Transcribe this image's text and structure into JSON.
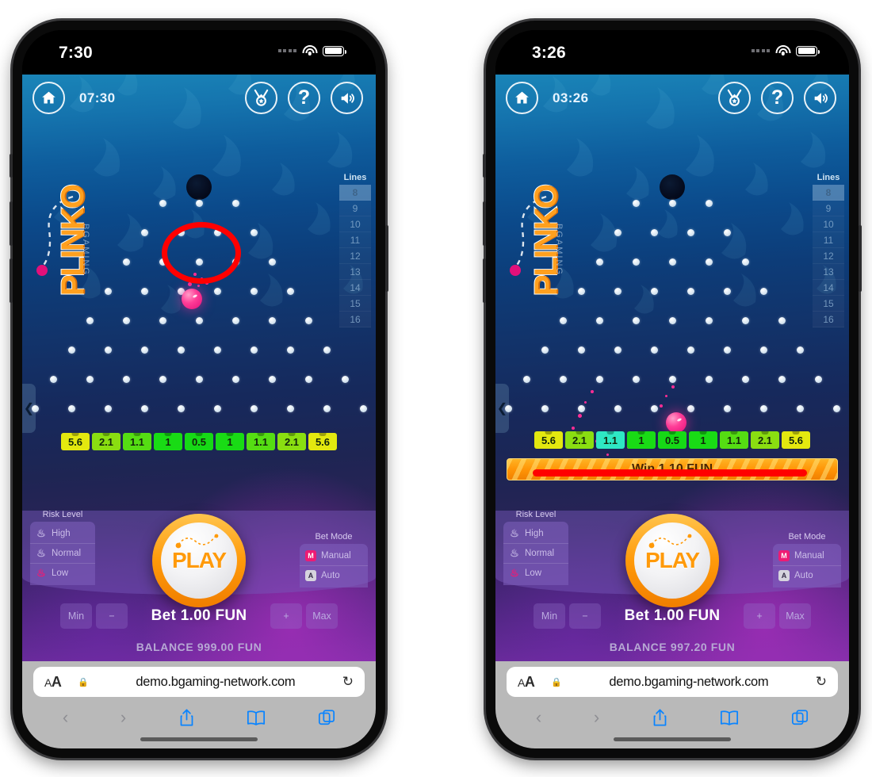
{
  "phones": [
    {
      "id": "left",
      "status": {
        "time": "7:30",
        "wifi_icon": "wifi-icon",
        "battery_icon": "battery-icon"
      },
      "game": {
        "clock": "07:30",
        "logo": "PLINKO",
        "logo_sub": "BGAMING",
        "home_icon": "home-icon",
        "medal_icon": "medal-icon",
        "help_icon": "question-mark-icon",
        "sound_icon": "speaker-icon",
        "collapse_icon": "chevron-left-icon",
        "lines_title": "Lines",
        "lines": [
          "8",
          "9",
          "10",
          "11",
          "12",
          "13",
          "14",
          "15",
          "16"
        ],
        "lines_selected": "8",
        "multipliers": [
          "5.6",
          "2.1",
          "1.1",
          "1",
          "0.5",
          "1",
          "1.1",
          "2.1",
          "5.6"
        ],
        "multiplier_highlight": -1,
        "win_banner": null,
        "risk_title": "Risk Level",
        "risk_options": [
          "High",
          "Normal",
          "Low"
        ],
        "risk_selected": "Low",
        "betmode_title": "Bet Mode",
        "betmode_options": [
          "Manual",
          "Auto"
        ],
        "betmode_badges": [
          "M",
          "A"
        ],
        "betmode_selected": "Manual",
        "play_label": "PLAY",
        "min_label": "Min",
        "minus_label": "−",
        "plus_label": "+",
        "max_label": "Max",
        "bet_text": "Bet 1.00 FUN",
        "balance_text": "BALANCE 999.00 FUN"
      },
      "safari": {
        "aa_label": "AA",
        "lock_icon": "lock-icon",
        "url": "demo.bgaming-network.com",
        "reload_icon": "reload-icon",
        "back_icon": "chevron-left-icon",
        "forward_icon": "chevron-right-icon",
        "share_icon": "share-icon",
        "bookmarks_icon": "book-icon",
        "tabs_icon": "tabs-icon"
      }
    },
    {
      "id": "right",
      "status": {
        "time": "3:26",
        "wifi_icon": "wifi-icon",
        "battery_icon": "battery-icon"
      },
      "game": {
        "clock": "03:26",
        "logo": "PLINKO",
        "logo_sub": "BGAMING",
        "home_icon": "home-icon",
        "medal_icon": "medal-icon",
        "help_icon": "question-mark-icon",
        "sound_icon": "speaker-icon",
        "collapse_icon": "chevron-left-icon",
        "lines_title": "Lines",
        "lines": [
          "8",
          "9",
          "10",
          "11",
          "12",
          "13",
          "14",
          "15",
          "16"
        ],
        "lines_selected": "8",
        "multipliers": [
          "5.6",
          "2.1",
          "1.1",
          "1",
          "0.5",
          "1",
          "1.1",
          "2.1",
          "5.6"
        ],
        "multiplier_highlight": 2,
        "win_banner": "Win 1.10 FUN",
        "risk_title": "Risk Level",
        "risk_options": [
          "High",
          "Normal",
          "Low"
        ],
        "risk_selected": "Low",
        "betmode_title": "Bet Mode",
        "betmode_options": [
          "Manual",
          "Auto"
        ],
        "betmode_badges": [
          "M",
          "A"
        ],
        "betmode_selected": "Manual",
        "play_label": "PLAY",
        "min_label": "Min",
        "minus_label": "−",
        "plus_label": "+",
        "max_label": "Max",
        "bet_text": "Bet 1.00 FUN",
        "balance_text": "BALANCE 997.20 FUN"
      },
      "safari": {
        "aa_label": "AA",
        "lock_icon": "lock-icon",
        "url": "demo.bgaming-network.com",
        "reload_icon": "reload-icon",
        "back_icon": "chevron-left-icon",
        "forward_icon": "chevron-right-icon",
        "share_icon": "share-icon",
        "bookmarks_icon": "book-icon",
        "tabs_icon": "tabs-icon"
      }
    }
  ],
  "colors": {
    "annotation_red": "#ff0000",
    "ball_pink": "#ff2d95",
    "play_orange": "#ff9a0a",
    "multiplier_yellow": "#e3e80f",
    "multiplier_green": "#16d916",
    "multiplier_highlight": "#2ee8c4",
    "safari_blue": "#0a84ff"
  },
  "peg_rows": [
    3,
    4,
    5,
    6,
    7,
    8,
    9,
    10
  ],
  "annotations": [
    {
      "type": "circle",
      "target": "ball-left"
    },
    {
      "type": "underline",
      "target": "win-banner-right"
    }
  ]
}
